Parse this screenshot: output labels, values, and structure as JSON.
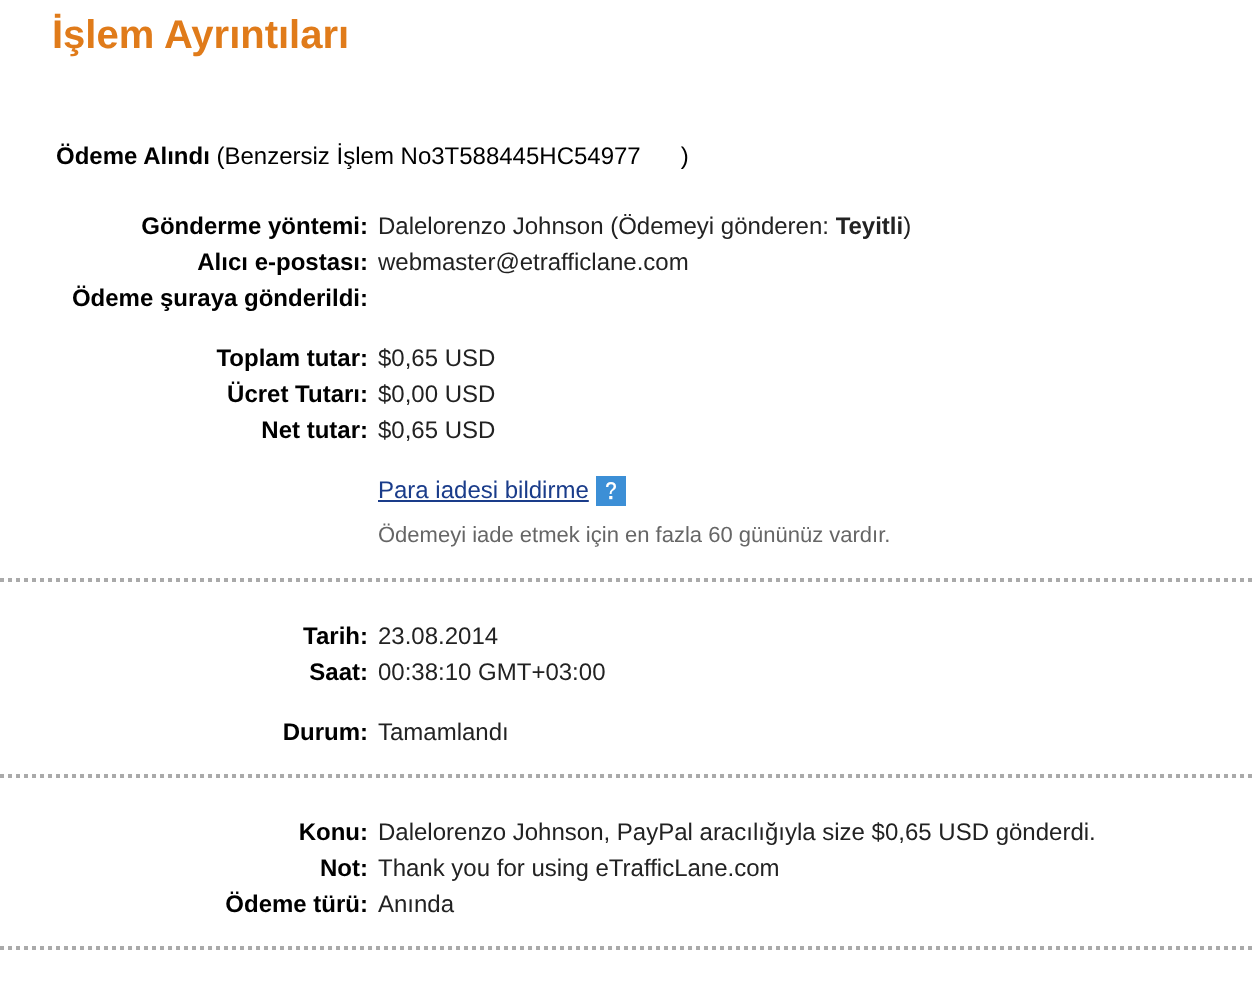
{
  "title": "İşlem Ayrıntıları",
  "header": {
    "label": "Ödeme Alındı",
    "text": "(Benzersiz İşlem No3T588445HC54977      )"
  },
  "sections": [
    {
      "groups": [
        [
          {
            "label": "Gönderme yöntemi:",
            "value": "Dalelorenzo Johnson (Ödemeyi gönderen: **Teyitli**)"
          },
          {
            "label": "Alıcı e-postası:",
            "value": "webmaster@etrafficlane.com"
          },
          {
            "label": "Ödeme şuraya gönderildi:"
          }
        ],
        [
          {
            "label": "Toplam tutar:",
            "value": "$0,65 USD"
          },
          {
            "label": "Ücret Tutarı:",
            "value": "$0,00 USD"
          },
          {
            "label": "Net tutar:",
            "value": "$0,65 USD"
          }
        ]
      ],
      "link": "Para iadesi bildirme",
      "note": "Ödemeyi iade etmek için en fazla 60 gününüz vardır."
    },
    {
      "groups": [
        [
          {
            "label": "Tarih:",
            "value": "23.08.2014"
          },
          {
            "label": "Saat:",
            "value": "00:38:10 GMT+03:00"
          }
        ],
        [
          {
            "label": "Durum:",
            "value": "Tamamlandı"
          }
        ]
      ]
    },
    {
      "groups": [
        [
          {
            "label": "Konu:",
            "value": "Dalelorenzo Johnson, PayPal aracılığıyla size $0,65 USD gönderdi."
          },
          {
            "label": "Not:",
            "value": "Thank you for using eTrafficLane.com"
          },
          {
            "label": "Ödeme türü:",
            "value": "Anında"
          }
        ]
      ]
    }
  ]
}
